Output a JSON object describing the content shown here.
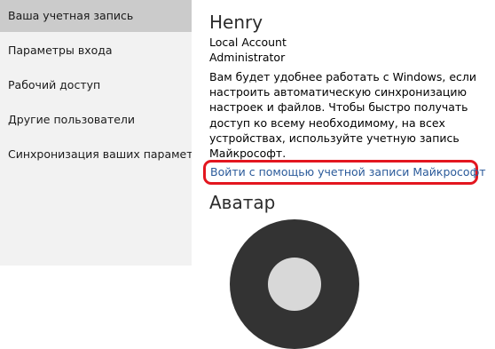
{
  "sidebar": {
    "items": [
      {
        "label": "Ваша учетная запись",
        "selected": true
      },
      {
        "label": "Параметры входа",
        "selected": false
      },
      {
        "label": "Рабочий доступ",
        "selected": false
      },
      {
        "label": "Другие пользователи",
        "selected": false
      },
      {
        "label": "Синхронизация ваших параметров",
        "selected": false
      }
    ]
  },
  "account": {
    "name": "Henry",
    "type": "Local Account",
    "role": "Administrator",
    "sync_description": "Вам будет удобнее работать с Windows, если настроить автоматическую синхронизацию настроек и файлов. Чтобы быстро получать доступ ко всему необходимому, на всех устройствах, используйте учетную запись Майкрософт.",
    "ms_link_label": "Войти с помощью учетной записи Майкрософт"
  },
  "avatar": {
    "heading": "Аватар"
  },
  "colors": {
    "sidebar_bg": "#f2f2f2",
    "selected_item_bg": "#cbcbcb",
    "link": "#2a5a9a",
    "highlight_border": "#e3161f"
  }
}
